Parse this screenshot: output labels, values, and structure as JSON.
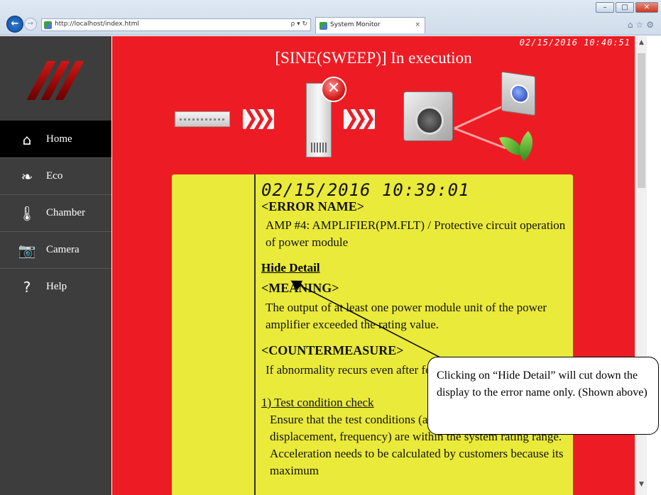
{
  "browser": {
    "url": "http://localhost/index.html",
    "tab_title": "System Monitor",
    "tab_close": "×",
    "address_icons": "ρ ▾ ↻"
  },
  "sidebar": {
    "items": [
      {
        "label": "Home",
        "icon": "home-icon",
        "glyph": "⌂",
        "active": true
      },
      {
        "label": "Eco",
        "icon": "leaf-icon",
        "glyph": "❧"
      },
      {
        "label": "Chamber",
        "icon": "thermometer-icon",
        "glyph": "🌡"
      },
      {
        "label": "Camera",
        "icon": "camera-icon",
        "glyph": "📷"
      },
      {
        "label": "Help",
        "icon": "help-icon",
        "glyph": "?"
      }
    ]
  },
  "main": {
    "datetime": "02/15/2016 10:40:51",
    "status_title": "[SINE(SWEEP)] In execution"
  },
  "error_panel": {
    "timestamp": "02/15/2016 10:39:01",
    "error_name_heading": "<ERROR NAME>",
    "error_name_text": "AMP #4: AMPLIFIER(PM.FLT) / Protective circuit operation of power module",
    "hide_detail_label": "Hide Detail",
    "meaning_heading": "<MEANING>",
    "meaning_text": "The output of at least one power module unit of the power amplifier exceeded the rating value.",
    "countermeasure_heading": "<COUNTERMEASURE>",
    "countermeasure_text": "If abnormality recurs even after following points, please contact",
    "check_heading": "1) Test condition check",
    "check_text": "Ensure that the test conditions (acceleration, velocity, displacement, frequency) are within the system rating range. Acceleration needs to be calculated by customers because its maximum"
  },
  "callout": {
    "text": "Clicking on “Hide Detail” will cut down the display to the error name only. (Shown above)"
  },
  "colors": {
    "main_bg": "#ed1c24",
    "panel_bg": "#eaea3a",
    "sidebar_bg": "#3d3d3d"
  }
}
